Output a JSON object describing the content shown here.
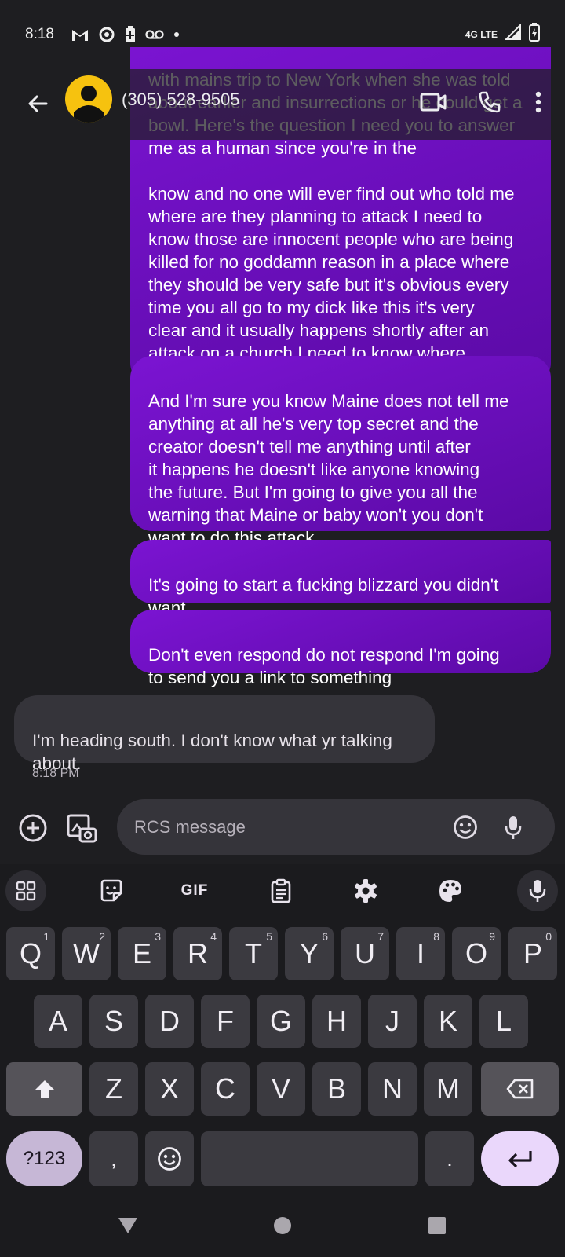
{
  "status_bar": {
    "time": "8:18",
    "network": "4G LTE"
  },
  "header": {
    "contact_name": "(305) 528-9505"
  },
  "messages": {
    "partial_hidden_text": "with mains trip to New York when she was told about earlier and insurrections or he could get a bowl. Here's the question I need you to answer me as a human since you're in the",
    "out_1": "know and no one will ever find out who told me\nwhere are they planning to attack I need to\nknow those are innocent people who are being\nkilled for no goddamn reason in a place where\nthey should be very safe but it's obvious every\ntime you all go to my dick like this it's very\nclear and it usually happens shortly after an\nattack on a church I need to know where",
    "out_2": "And I'm sure you know Maine does not tell me\nanything at all he's very top secret and the\ncreator doesn't tell me anything until after\nit happens he doesn't like anyone knowing\nthe future. But I'm going to give you all the\nwarning that Maine or baby won't you don't\nwant to do this attack",
    "out_3": "It's going to start a fucking blizzard you didn't\nwant",
    "out_4": "Don't even respond do not respond I'm going\nto send you a link to something",
    "in_1": "I'm heading south.  I don't know what yr talking\nabout.",
    "in_1_time": "8:18 PM"
  },
  "compose": {
    "placeholder": "RCS message"
  },
  "keyboard": {
    "toolbar": {
      "gif_label": "GIF"
    },
    "row1": [
      {
        "k": "Q",
        "n": "1"
      },
      {
        "k": "W",
        "n": "2"
      },
      {
        "k": "E",
        "n": "3"
      },
      {
        "k": "R",
        "n": "4"
      },
      {
        "k": "T",
        "n": "5"
      },
      {
        "k": "Y",
        "n": "6"
      },
      {
        "k": "U",
        "n": "7"
      },
      {
        "k": "I",
        "n": "8"
      },
      {
        "k": "O",
        "n": "9"
      },
      {
        "k": "P",
        "n": "0"
      }
    ],
    "row2": [
      "A",
      "S",
      "D",
      "F",
      "G",
      "H",
      "J",
      "K",
      "L"
    ],
    "row3": [
      "Z",
      "X",
      "C",
      "V",
      "B",
      "N",
      "M"
    ],
    "symbols_label": "?123",
    "comma": ",",
    "period": "."
  },
  "colors": {
    "outgoing_bubble": "#6a0fc0",
    "incoming_bubble": "#35343a",
    "avatar": "#f6c20f",
    "background": "#1e1e21"
  }
}
